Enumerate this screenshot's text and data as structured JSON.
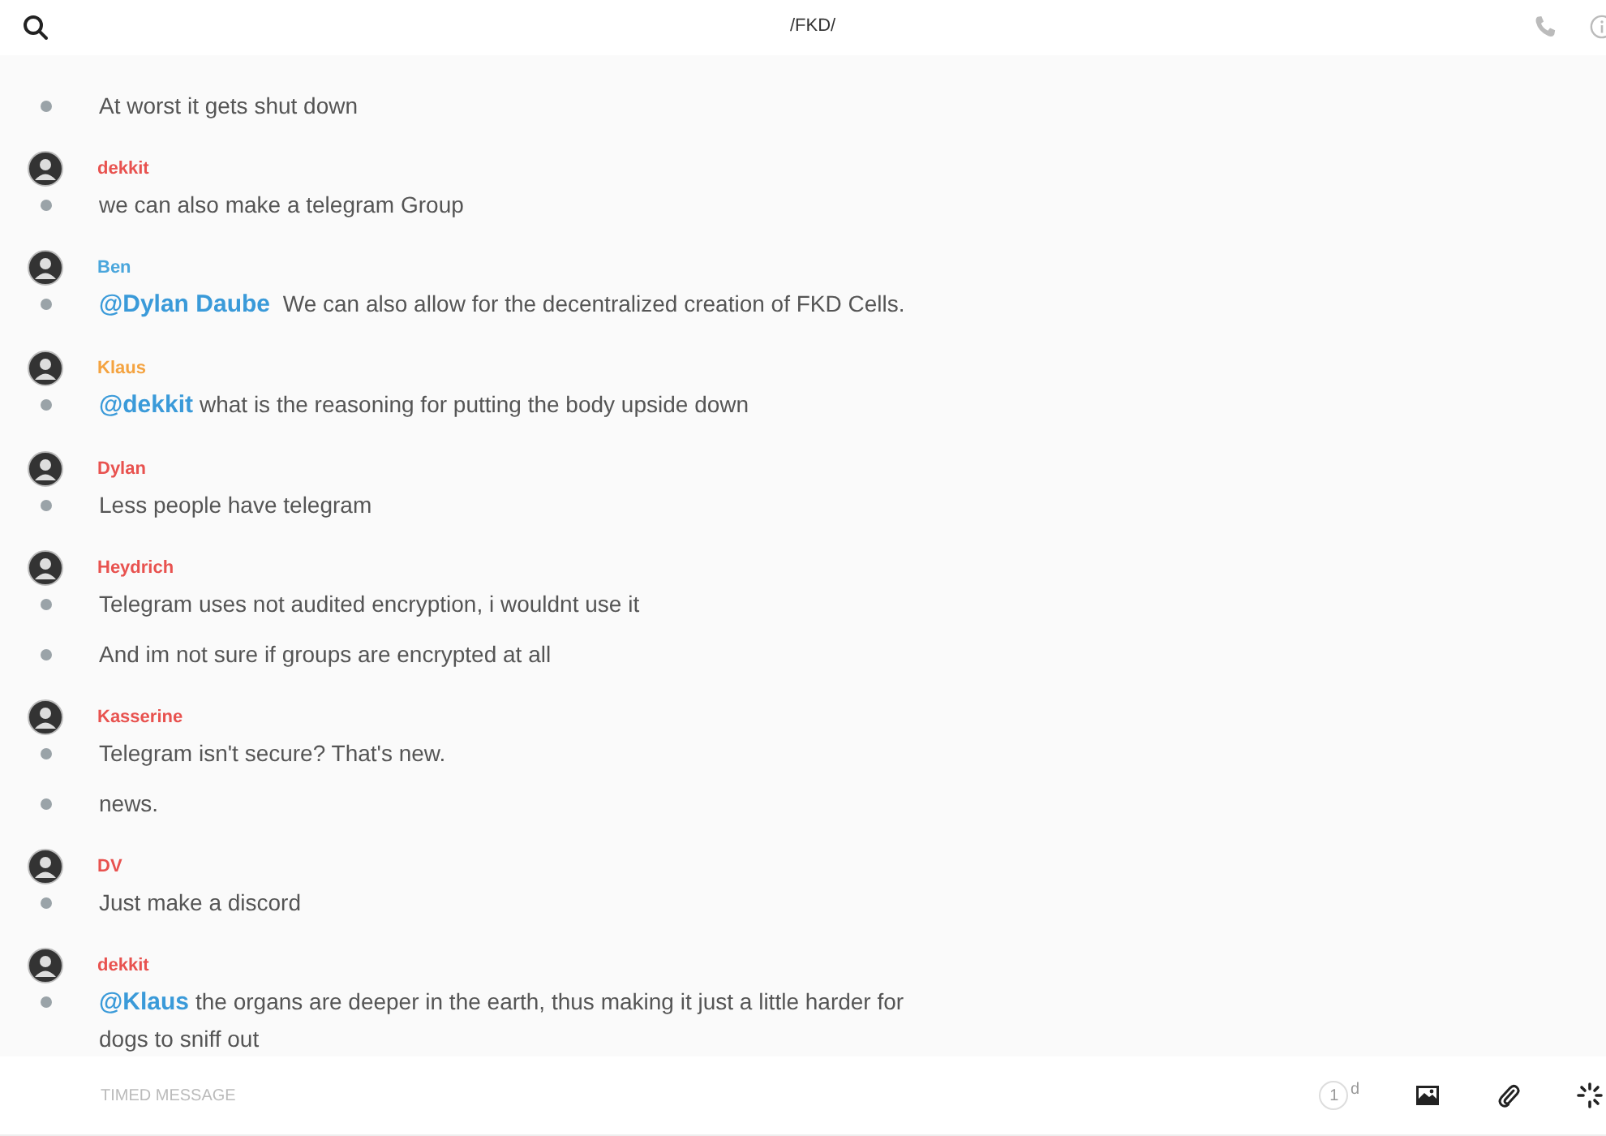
{
  "header": {
    "title": "/FKD/"
  },
  "groups": [
    {
      "messages": [
        {
          "text": "At worst it gets shut down"
        }
      ]
    },
    {
      "author": "dekkit",
      "color": "#e8524f",
      "messages": [
        {
          "text": "we can also make a telegram Group"
        }
      ]
    },
    {
      "author": "Ben",
      "color": "#4aa6dc",
      "messages": [
        {
          "mention": "@Dylan Daube",
          "text": " We can also allow for the decentralized creation of FKD Cells."
        }
      ]
    },
    {
      "author": "Klaus",
      "color": "#f4a340",
      "messages": [
        {
          "mention": "@dekkit",
          "text": "what is the reasoning for putting the body upside down"
        }
      ]
    },
    {
      "author": "Dylan",
      "color": "#e8524f",
      "messages": [
        {
          "text": "Less people have telegram"
        }
      ]
    },
    {
      "author": "Heydrich",
      "color": "#e8524f",
      "messages": [
        {
          "text": "Telegram uses not audited encryption, i wouldnt use it"
        },
        {
          "text": "And im not sure if groups are encrypted at all"
        }
      ]
    },
    {
      "author": "Kasserine",
      "color": "#e8524f",
      "messages": [
        {
          "text": "Telegram isn't secure? That's new."
        },
        {
          "text": "news."
        }
      ]
    },
    {
      "author": "DV",
      "color": "#e8524f",
      "messages": [
        {
          "text": "Just make a discord"
        }
      ]
    },
    {
      "author": "dekkit",
      "color": "#e8524f",
      "messages": [
        {
          "mention": "@Klaus",
          "text": "the organs are deeper in the earth, thus making it just a little harder for dogs to sniff out"
        }
      ]
    }
  ],
  "composer": {
    "placeholder": "TIMED MESSAGE",
    "timer": "1",
    "timer_unit": "d"
  }
}
